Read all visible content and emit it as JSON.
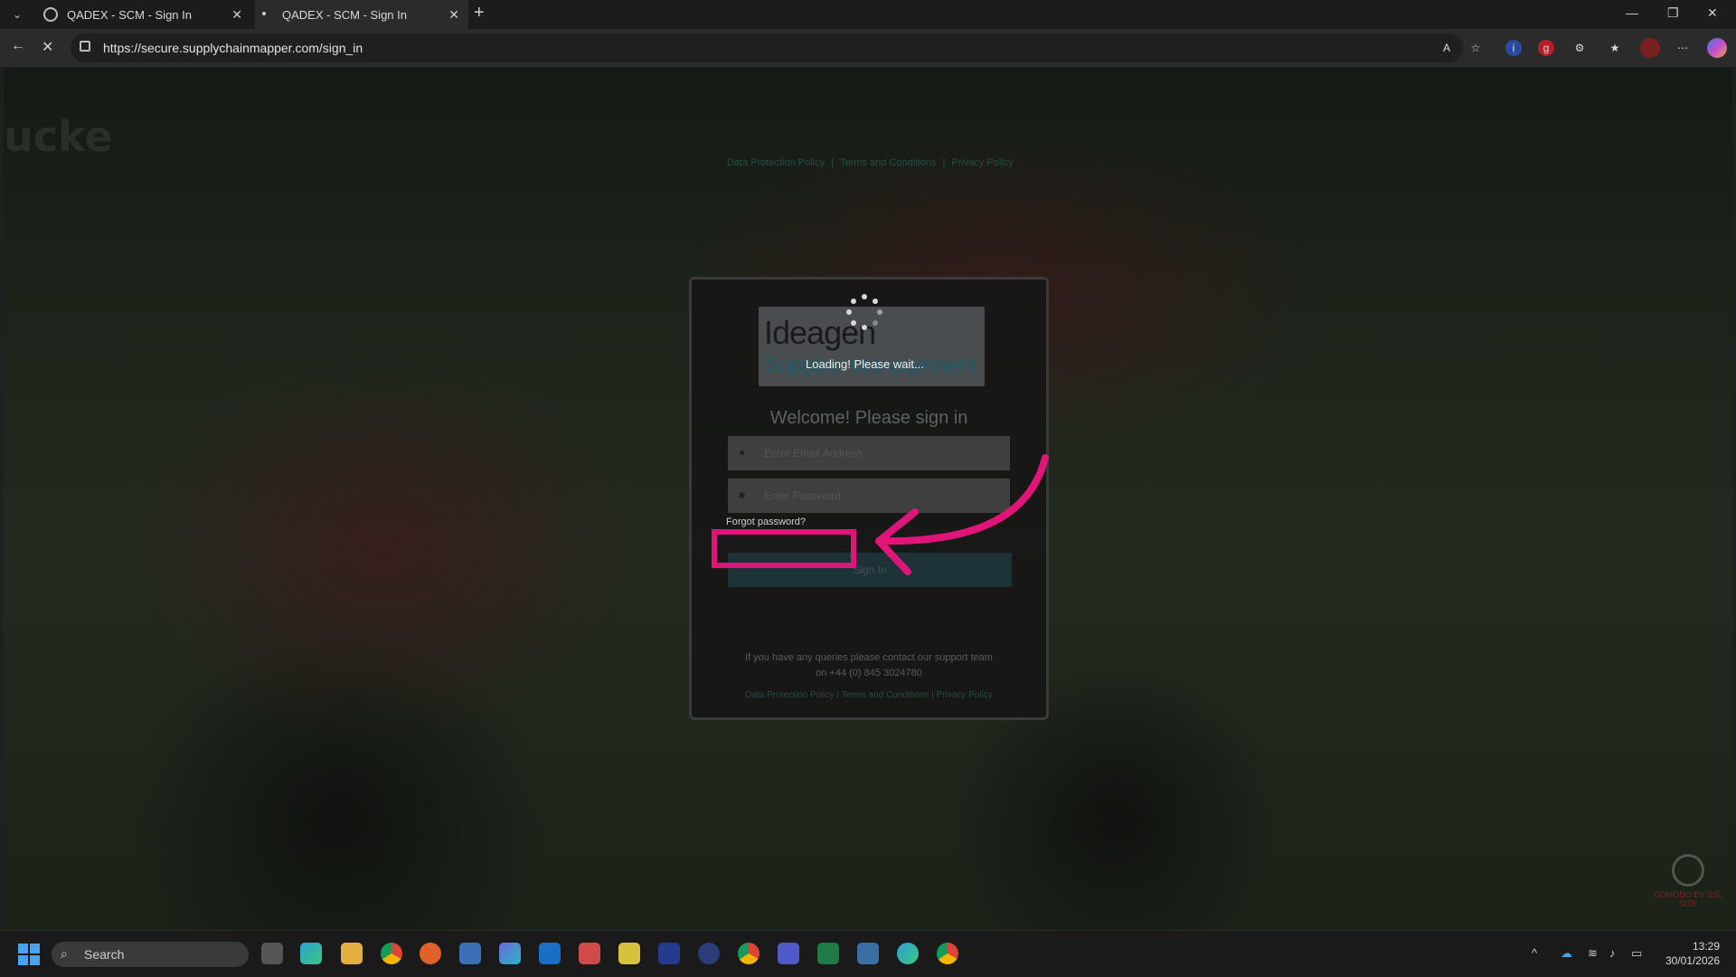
{
  "browser": {
    "tabs": [
      {
        "title": "QADEX - SCM - Sign In"
      },
      {
        "title": "QADEX - SCM - Sign In"
      }
    ],
    "url": "https://secure.supplychainmapper.com/sign_in"
  },
  "page": {
    "background_brand": "ucke",
    "top_links": [
      "Data Protection Policy",
      "|",
      "Terms and Conditions",
      "|",
      "Privacy Policy"
    ],
    "logo": {
      "line1": "Ideagen",
      "line2": "Supplier Management"
    },
    "loading_text": "Loading! Please wait...",
    "welcome": "Welcome! Please sign in",
    "email_placeholder": "Enter Email Address",
    "password_placeholder": "Enter Password",
    "forgot_password": "Forgot password?",
    "signin_label": "Sign In",
    "support_line1": "If you have any queries please contact our support team",
    "support_line2": "on +44 (0) 845 3024780",
    "bottom_links": [
      "Data Protection Policy",
      "|",
      "Terms and Conditions",
      "|",
      "Privacy Policy"
    ],
    "seal_text": "COMODO EV SSL SITE",
    "annotation_color": "#e0157a"
  },
  "taskbar": {
    "search_label": "Search",
    "time": "13:29",
    "date": "30/01/2026"
  }
}
